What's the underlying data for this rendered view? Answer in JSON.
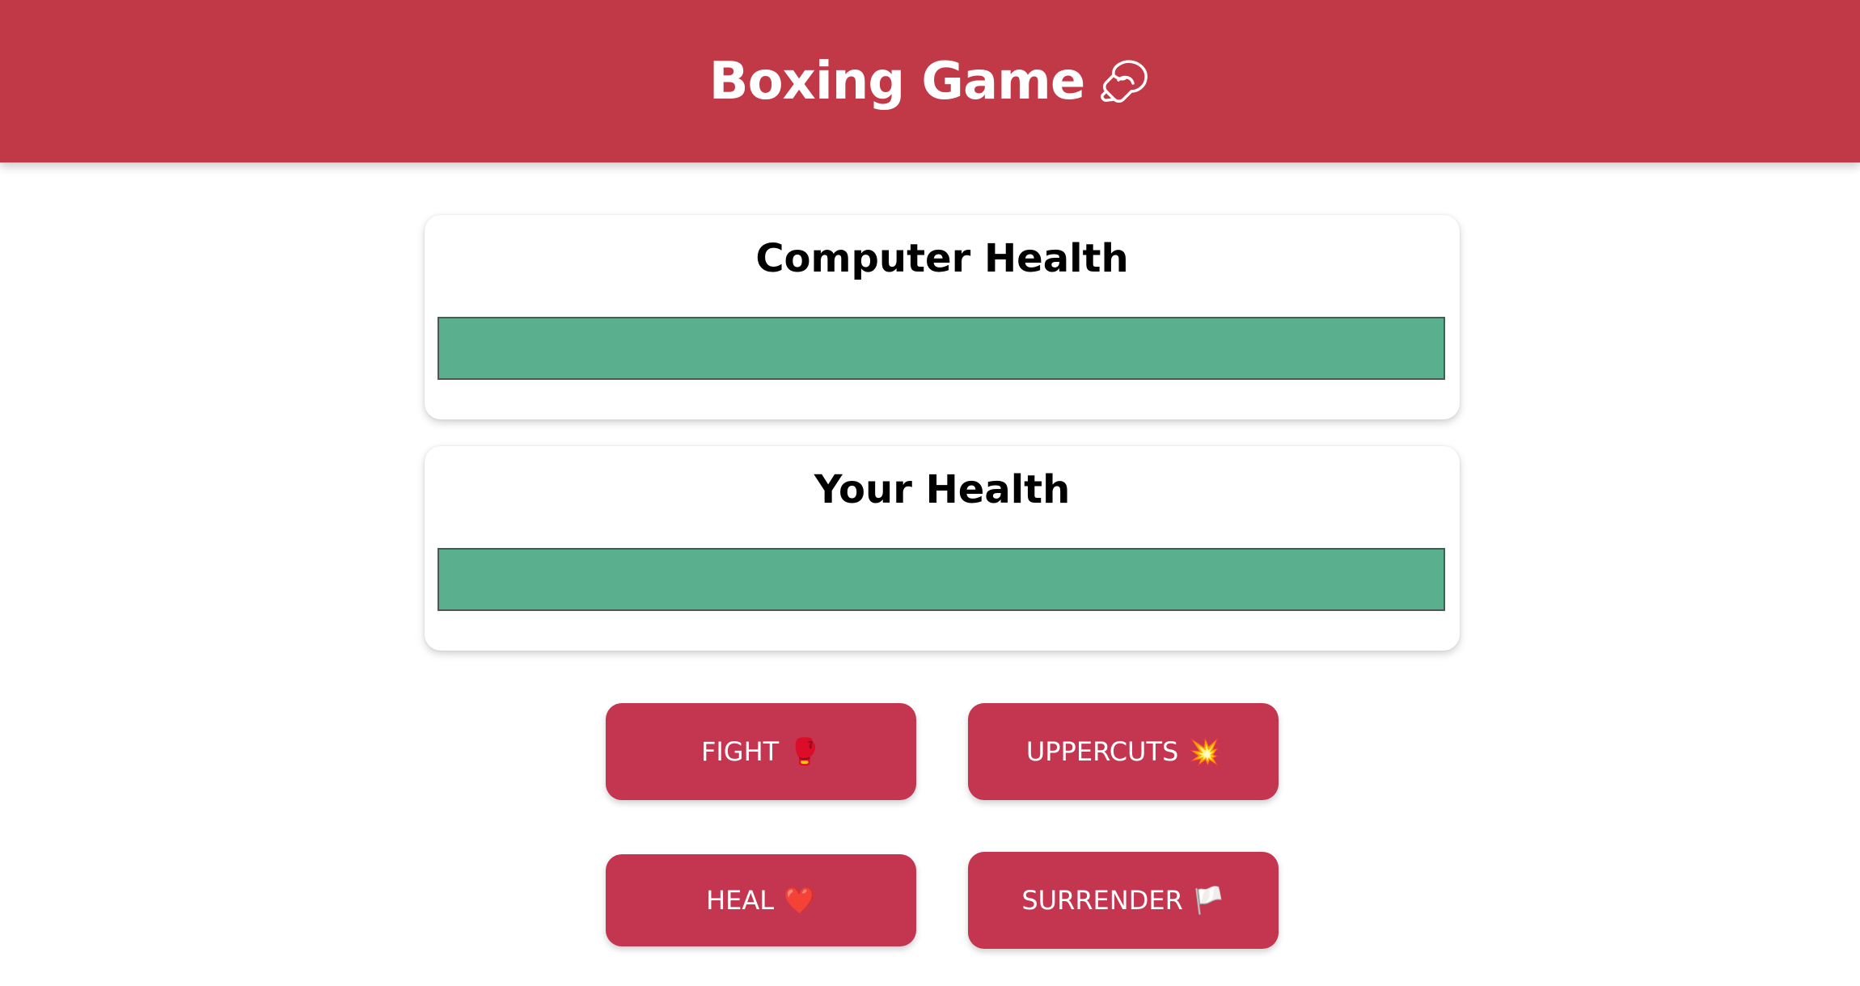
{
  "header": {
    "title": "Boxing Game",
    "title_icon": "boxing-glove-icon",
    "background_color": "#c13847"
  },
  "computer": {
    "title": "Computer Health",
    "health_percent": 100,
    "bar_color": "#5ab08e"
  },
  "player": {
    "title": "Your Health",
    "health_percent": 100,
    "bar_color": "#5ab08e"
  },
  "actions": {
    "fight": {
      "label": "FIGHT",
      "emoji": "🥊"
    },
    "uppercuts": {
      "label": "UPPERCUTS",
      "emoji": "💥"
    },
    "heal": {
      "label": "HEAL",
      "emoji": "❤️"
    },
    "surrender": {
      "label": "SURRENDER",
      "emoji": "🏳️"
    },
    "button_color": "#c43550"
  }
}
